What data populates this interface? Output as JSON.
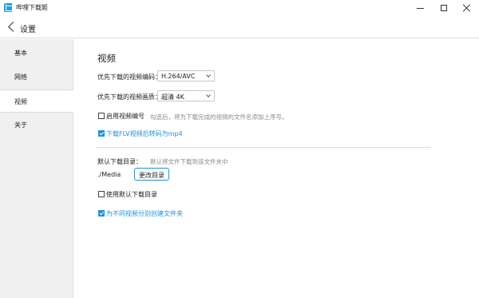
{
  "window": {
    "app_title": "哔哩下载姬",
    "app_icon": "bilibili-tv-icon"
  },
  "header": {
    "title": "设置",
    "back_icon": "chevron-left-icon"
  },
  "sidebar": {
    "items": [
      {
        "label": "基本",
        "active": false
      },
      {
        "label": "网络",
        "active": false
      },
      {
        "label": "视频",
        "active": true
      },
      {
        "label": "关于",
        "active": false
      }
    ]
  },
  "main": {
    "section_title": "视频",
    "codec": {
      "label": "优先下载的视频编码：",
      "value": "H.264/AVC"
    },
    "quality": {
      "label": "优先下载的视频画质：",
      "value": "超清 4K"
    },
    "enable_numbering": {
      "label": "启用视频编号",
      "checked": false,
      "hint": "勾选后，将为下载完成的视频的文件名添加上序号。"
    },
    "flv_to_mp4": {
      "label": "下载FLV视频后转码为mp4",
      "checked": true
    },
    "default_dir": {
      "label": "默认下载目录：",
      "hint": "默认将文件下载到该文件夹中",
      "path": "./Media",
      "change_button": "更改目录"
    },
    "use_default_dir": {
      "label": "使用默认下载目录",
      "checked": false
    },
    "folder_per_video": {
      "label": "为不同视频分别创建文件夹",
      "checked": true
    }
  },
  "colors": {
    "accent": "#1f93d6",
    "sidebar_bg": "#f0f0f0",
    "hint_text": "#8a8a8a"
  }
}
